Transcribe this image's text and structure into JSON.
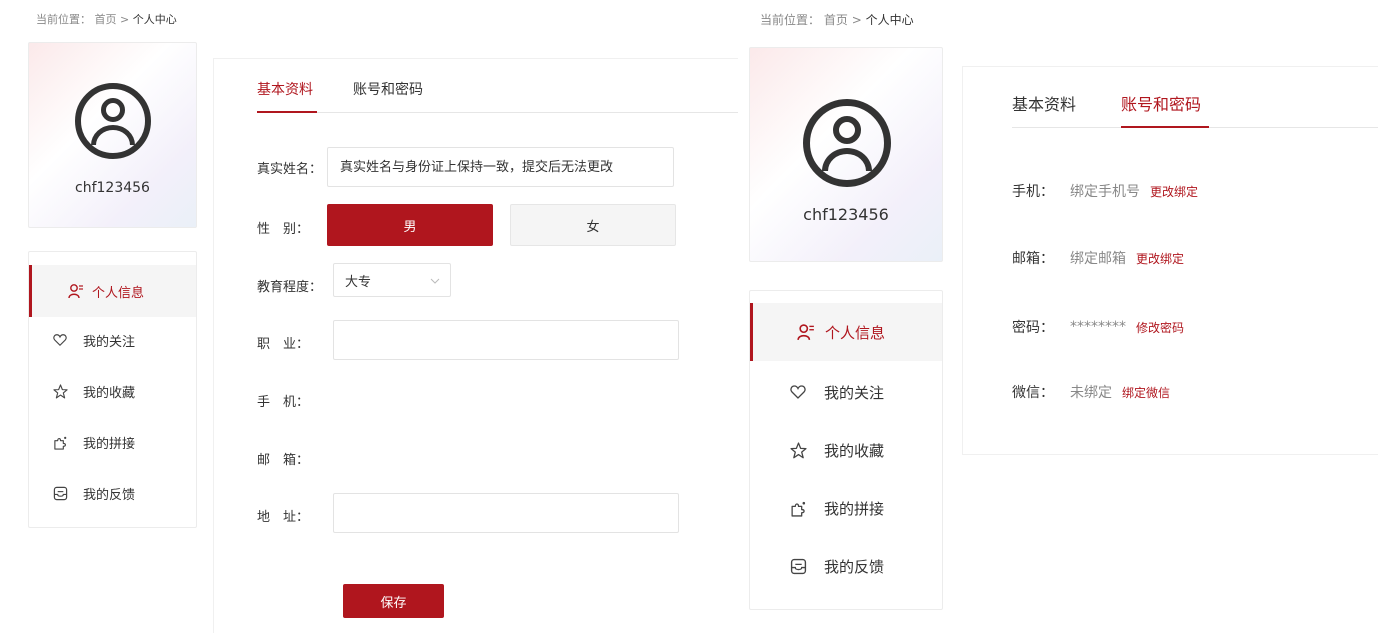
{
  "breadcrumb": {
    "prefix": "当前位置：",
    "home": "首页",
    "sep": ">",
    "current": "个人中心"
  },
  "user": {
    "name": "chf123456"
  },
  "menu": [
    {
      "label": "个人信息",
      "icon": "user-list-icon",
      "active": true
    },
    {
      "label": "我的关注",
      "icon": "heart-icon",
      "active": false
    },
    {
      "label": "我的收藏",
      "icon": "star-icon",
      "active": false
    },
    {
      "label": "我的拼接",
      "icon": "puzzle-icon",
      "active": false
    },
    {
      "label": "我的反馈",
      "icon": "feedback-icon",
      "active": false
    }
  ],
  "tabs": {
    "basic": "基本资料",
    "account": "账号和密码"
  },
  "form": {
    "realname": {
      "label": "真实姓名：",
      "placeholder": "真实姓名与身份证上保持一致，提交后无法更改"
    },
    "gender": {
      "label": "性　别：",
      "male": "男",
      "female": "女",
      "selected": "男"
    },
    "education": {
      "label": "教育程度：",
      "value": "大专"
    },
    "job": {
      "label": "职　业：",
      "value": ""
    },
    "phone": {
      "label": "手　机："
    },
    "email": {
      "label": "邮　箱："
    },
    "address": {
      "label": "地　址：",
      "value": ""
    },
    "save": "保存"
  },
  "account": {
    "phone": {
      "label": "手机：",
      "value": "绑定手机号",
      "action": "更改绑定"
    },
    "email": {
      "label": "邮箱：",
      "value": "绑定邮箱",
      "action": "更改绑定"
    },
    "password": {
      "label": "密码：",
      "value": "********",
      "action": "修改密码"
    },
    "wechat": {
      "label": "微信：",
      "value": "未绑定",
      "action": "绑定微信"
    }
  },
  "colors": {
    "accent": "#b0161e",
    "muted": "#888888",
    "text": "#333333"
  }
}
